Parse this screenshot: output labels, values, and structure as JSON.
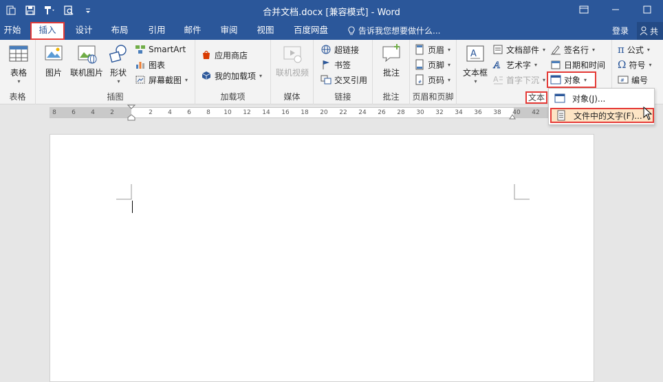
{
  "titlebar": {
    "title": "合并文档.docx [兼容模式] - Word",
    "qat_icons": [
      "file-icon",
      "save-icon",
      "format-painter-icon",
      "print-preview-icon",
      "customize-icon"
    ]
  },
  "tabs": {
    "items": [
      "开始",
      "插入",
      "设计",
      "布局",
      "引用",
      "邮件",
      "审阅",
      "视图",
      "百度网盘"
    ],
    "active": "插入",
    "tellme": "告诉我您想要做什么...",
    "login": "登录",
    "share": "共"
  },
  "ribbon": {
    "table": {
      "label": "表格",
      "group": "表格"
    },
    "illustrations": {
      "group": "插图",
      "picture": "图片",
      "online_picture": "联机图片",
      "shapes": "形状",
      "smartart": "SmartArt",
      "chart": "图表",
      "screenshot": "屏幕截图"
    },
    "addins": {
      "group": "加载项",
      "store": "应用商店",
      "my_addins": "我的加载项"
    },
    "media": {
      "group": "媒体",
      "online_video": "联机视频"
    },
    "links": {
      "group": "链接",
      "hyperlink": "超链接",
      "bookmark": "书签",
      "cross_ref": "交叉引用"
    },
    "comments": {
      "group": "批注",
      "comment": "批注"
    },
    "header_footer": {
      "group": "页眉和页脚",
      "header": "页眉",
      "footer": "页脚",
      "page_number": "页码"
    },
    "text": {
      "group": "文本",
      "textbox": "文本框",
      "quick_parts": "文档部件",
      "wordart": "艺术字",
      "dropcap": "首字下沉",
      "signature": "签名行",
      "datetime": "日期和时间",
      "object": "对象"
    },
    "symbols": {
      "equation": "公式",
      "symbol": "符号",
      "numbering": "编号"
    }
  },
  "ruler": {
    "ticks": [
      "8",
      "6",
      "4",
      "2",
      "2",
      "4",
      "6",
      "8",
      "10",
      "12",
      "14",
      "16",
      "18",
      "20",
      "22",
      "24",
      "26",
      "28",
      "30",
      "32",
      "34",
      "36",
      "38",
      "40",
      "42"
    ]
  },
  "object_menu": {
    "items": [
      "对象(J)...",
      "文件中的文字(F)..."
    ],
    "highlighted_index": 1
  },
  "colors": {
    "brand": "#2b579a",
    "highlight_outline": "#e53935",
    "menu_hover": "#fde5c5"
  }
}
